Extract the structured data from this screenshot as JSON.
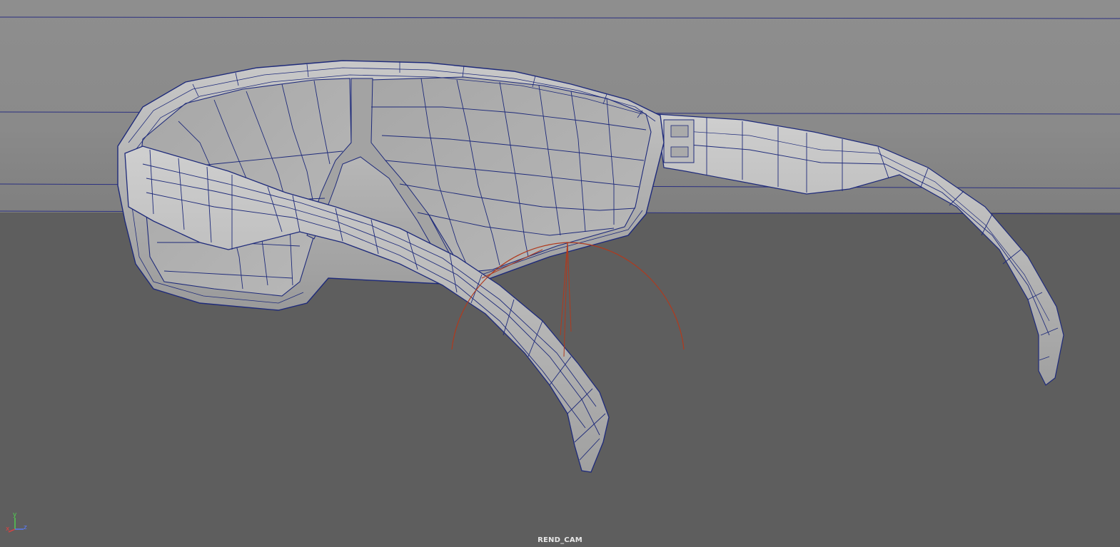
{
  "viewport": {
    "camera_name": "REND_CAM",
    "background_color": "#8b8b8b",
    "floor_color": "#5e5e5e",
    "wireframe_color": "#1e2a7a",
    "manipulator_color": "#b03a1e",
    "axis": {
      "y_label": "y",
      "x_label": "x",
      "z_label": "z",
      "y_color": "#4fd24f",
      "x_color": "#e04040",
      "z_color": "#5a7cff"
    }
  }
}
